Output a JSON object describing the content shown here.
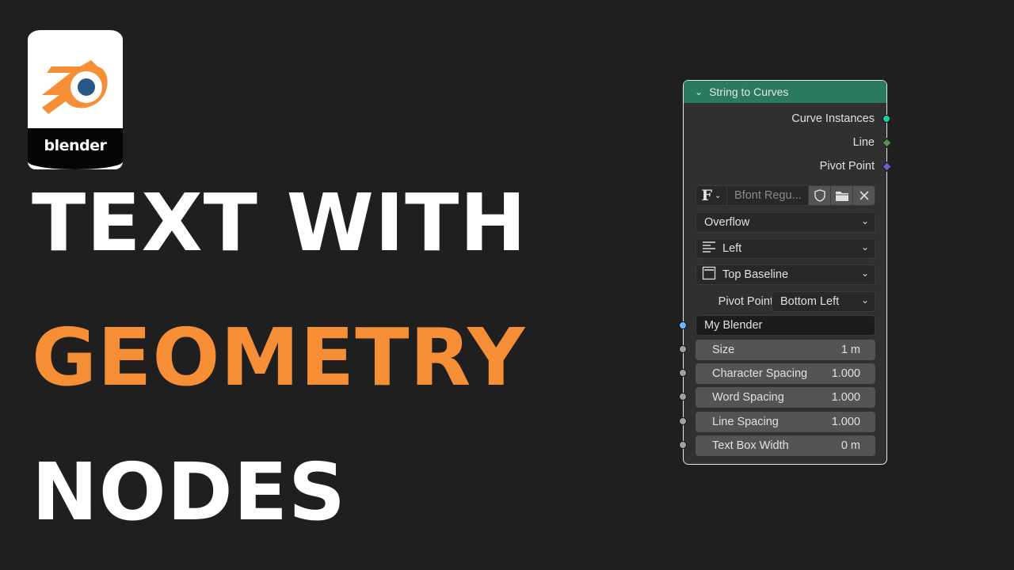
{
  "logo": {
    "wordmark": "blender",
    "colors": {
      "orange": "#f58e35",
      "blue": "#265787"
    }
  },
  "headline": {
    "line1": "TEXT WITH",
    "line2": "GEOMETRY",
    "line3": "NODES",
    "accent_color": "#f58e35"
  },
  "node": {
    "title": "String to Curves",
    "header_color": "#2a7a62",
    "outputs": [
      {
        "label": "Curve Instances",
        "socket_color": "#1dcfa9"
      },
      {
        "label": "Line",
        "socket_color": "#5a8a5a"
      },
      {
        "label": "Pivot Point",
        "socket_color": "#6363c7"
      }
    ],
    "font_field": {
      "glyph": "F",
      "name": "Bfont Regu..."
    },
    "overflow": "Overflow",
    "align_x": "Left",
    "align_y": "Top Baseline",
    "pivot": {
      "label": "Pivot Point",
      "value": "Bottom Left"
    },
    "string_value": "My Blender",
    "fields": [
      {
        "label": "Size",
        "value": "1 m"
      },
      {
        "label": "Character Spacing",
        "value": "1.000"
      },
      {
        "label": "Word Spacing",
        "value": "1.000"
      },
      {
        "label": "Line Spacing",
        "value": "1.000"
      },
      {
        "label": "Text Box Width",
        "value": "0 m"
      }
    ],
    "string_socket_color": "#70b2ff",
    "float_socket_color": "#a1a1a1"
  }
}
